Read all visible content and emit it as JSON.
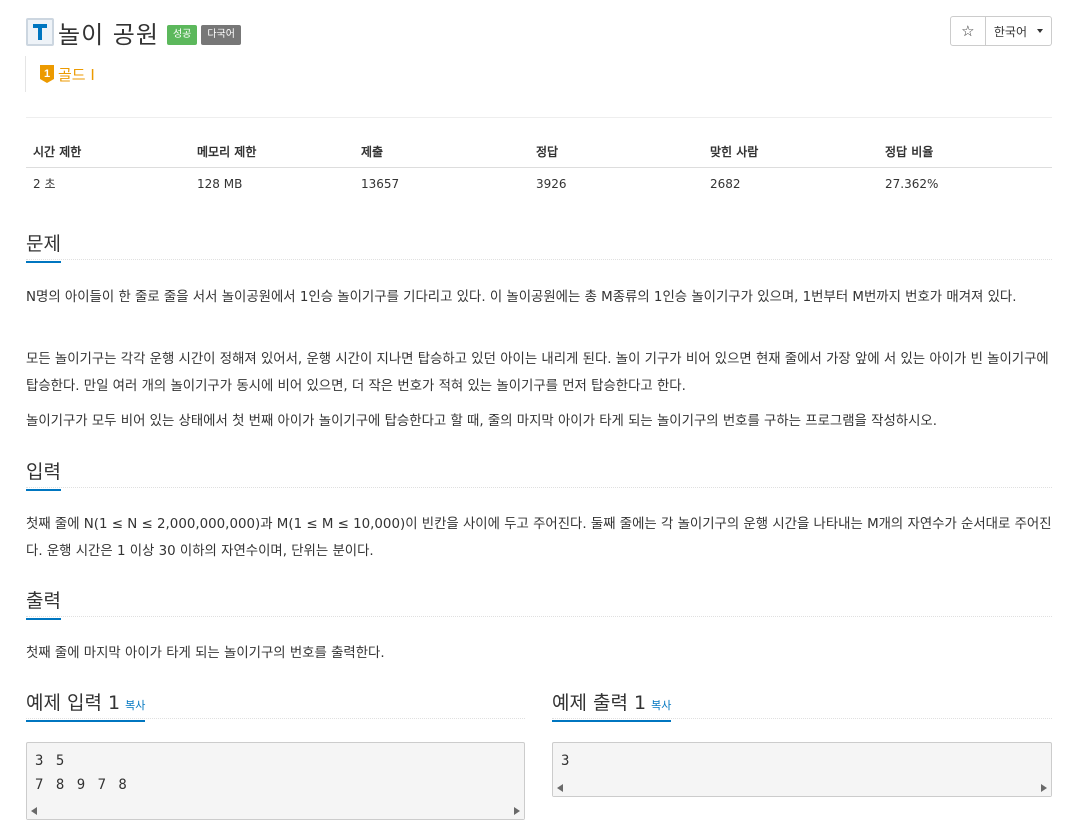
{
  "header": {
    "title": "놀이 공원",
    "badges": {
      "success": "성공",
      "language": "다국어"
    },
    "language_select": "한국어",
    "tier": {
      "number": "1",
      "label": "골드 I"
    }
  },
  "info_table": {
    "headers": [
      "시간 제한",
      "메모리 제한",
      "제출",
      "정답",
      "맞힌 사람",
      "정답 비율"
    ],
    "values": [
      "2 초",
      "128 MB",
      "13657",
      "3926",
      "2682",
      "27.362%"
    ]
  },
  "problem": {
    "title": "문제",
    "paragraphs": [
      "N명의 아이들이 한 줄로 줄을 서서 놀이공원에서 1인승 놀이기구를 기다리고 있다. 이 놀이공원에는 총 M종류의 1인승 놀이기구가 있으며, 1번부터 M번까지 번호가 매겨져 있다.",
      "모든 놀이기구는 각각 운행 시간이 정해져 있어서, 운행 시간이 지나면 탑승하고 있던 아이는 내리게 된다. 놀이 기구가 비어 있으면 현재 줄에서 가장 앞에 서 있는 아이가 빈 놀이기구에 탑승한다. 만일 여러 개의 놀이기구가 동시에 비어 있으면, 더 작은 번호가 적혀 있는 놀이기구를 먼저 탑승한다고 한다.",
      "놀이기구가 모두 비어 있는 상태에서 첫 번째 아이가 놀이기구에 탑승한다고 할 때, 줄의 마지막 아이가 타게 되는 놀이기구의 번호를 구하는 프로그램을 작성하시오."
    ]
  },
  "input": {
    "title": "입력",
    "text": "첫째 줄에 N(1 ≤ N ≤ 2,000,000,000)과 M(1 ≤ M ≤ 10,000)이 빈칸을 사이에 두고 주어진다. 둘째 줄에는 각 놀이기구의 운행 시간을 나타내는 M개의 자연수가 순서대로 주어진다. 운행 시간은 1 이상 30 이하의 자연수이며, 단위는 분이다."
  },
  "output": {
    "title": "출력",
    "text": "첫째 줄에 마지막 아이가 타게 되는 놀이기구의 번호를 출력한다."
  },
  "sample_input": {
    "title": "예제 입력 1",
    "copy_label": "복사",
    "lines": [
      "3 5",
      "7 8 9 7 8"
    ]
  },
  "sample_output": {
    "title": "예제 출력 1",
    "copy_label": "복사",
    "lines": [
      "3"
    ]
  },
  "colors": {
    "accent": "#0076c0",
    "success": "#5cb85c",
    "gold": "#ec9a00",
    "badge_gray": "#777777"
  },
  "icons": {
    "logo": "letter-t-logo-icon",
    "star": "star-outline-icon",
    "tier": "gold-tier-icon"
  }
}
